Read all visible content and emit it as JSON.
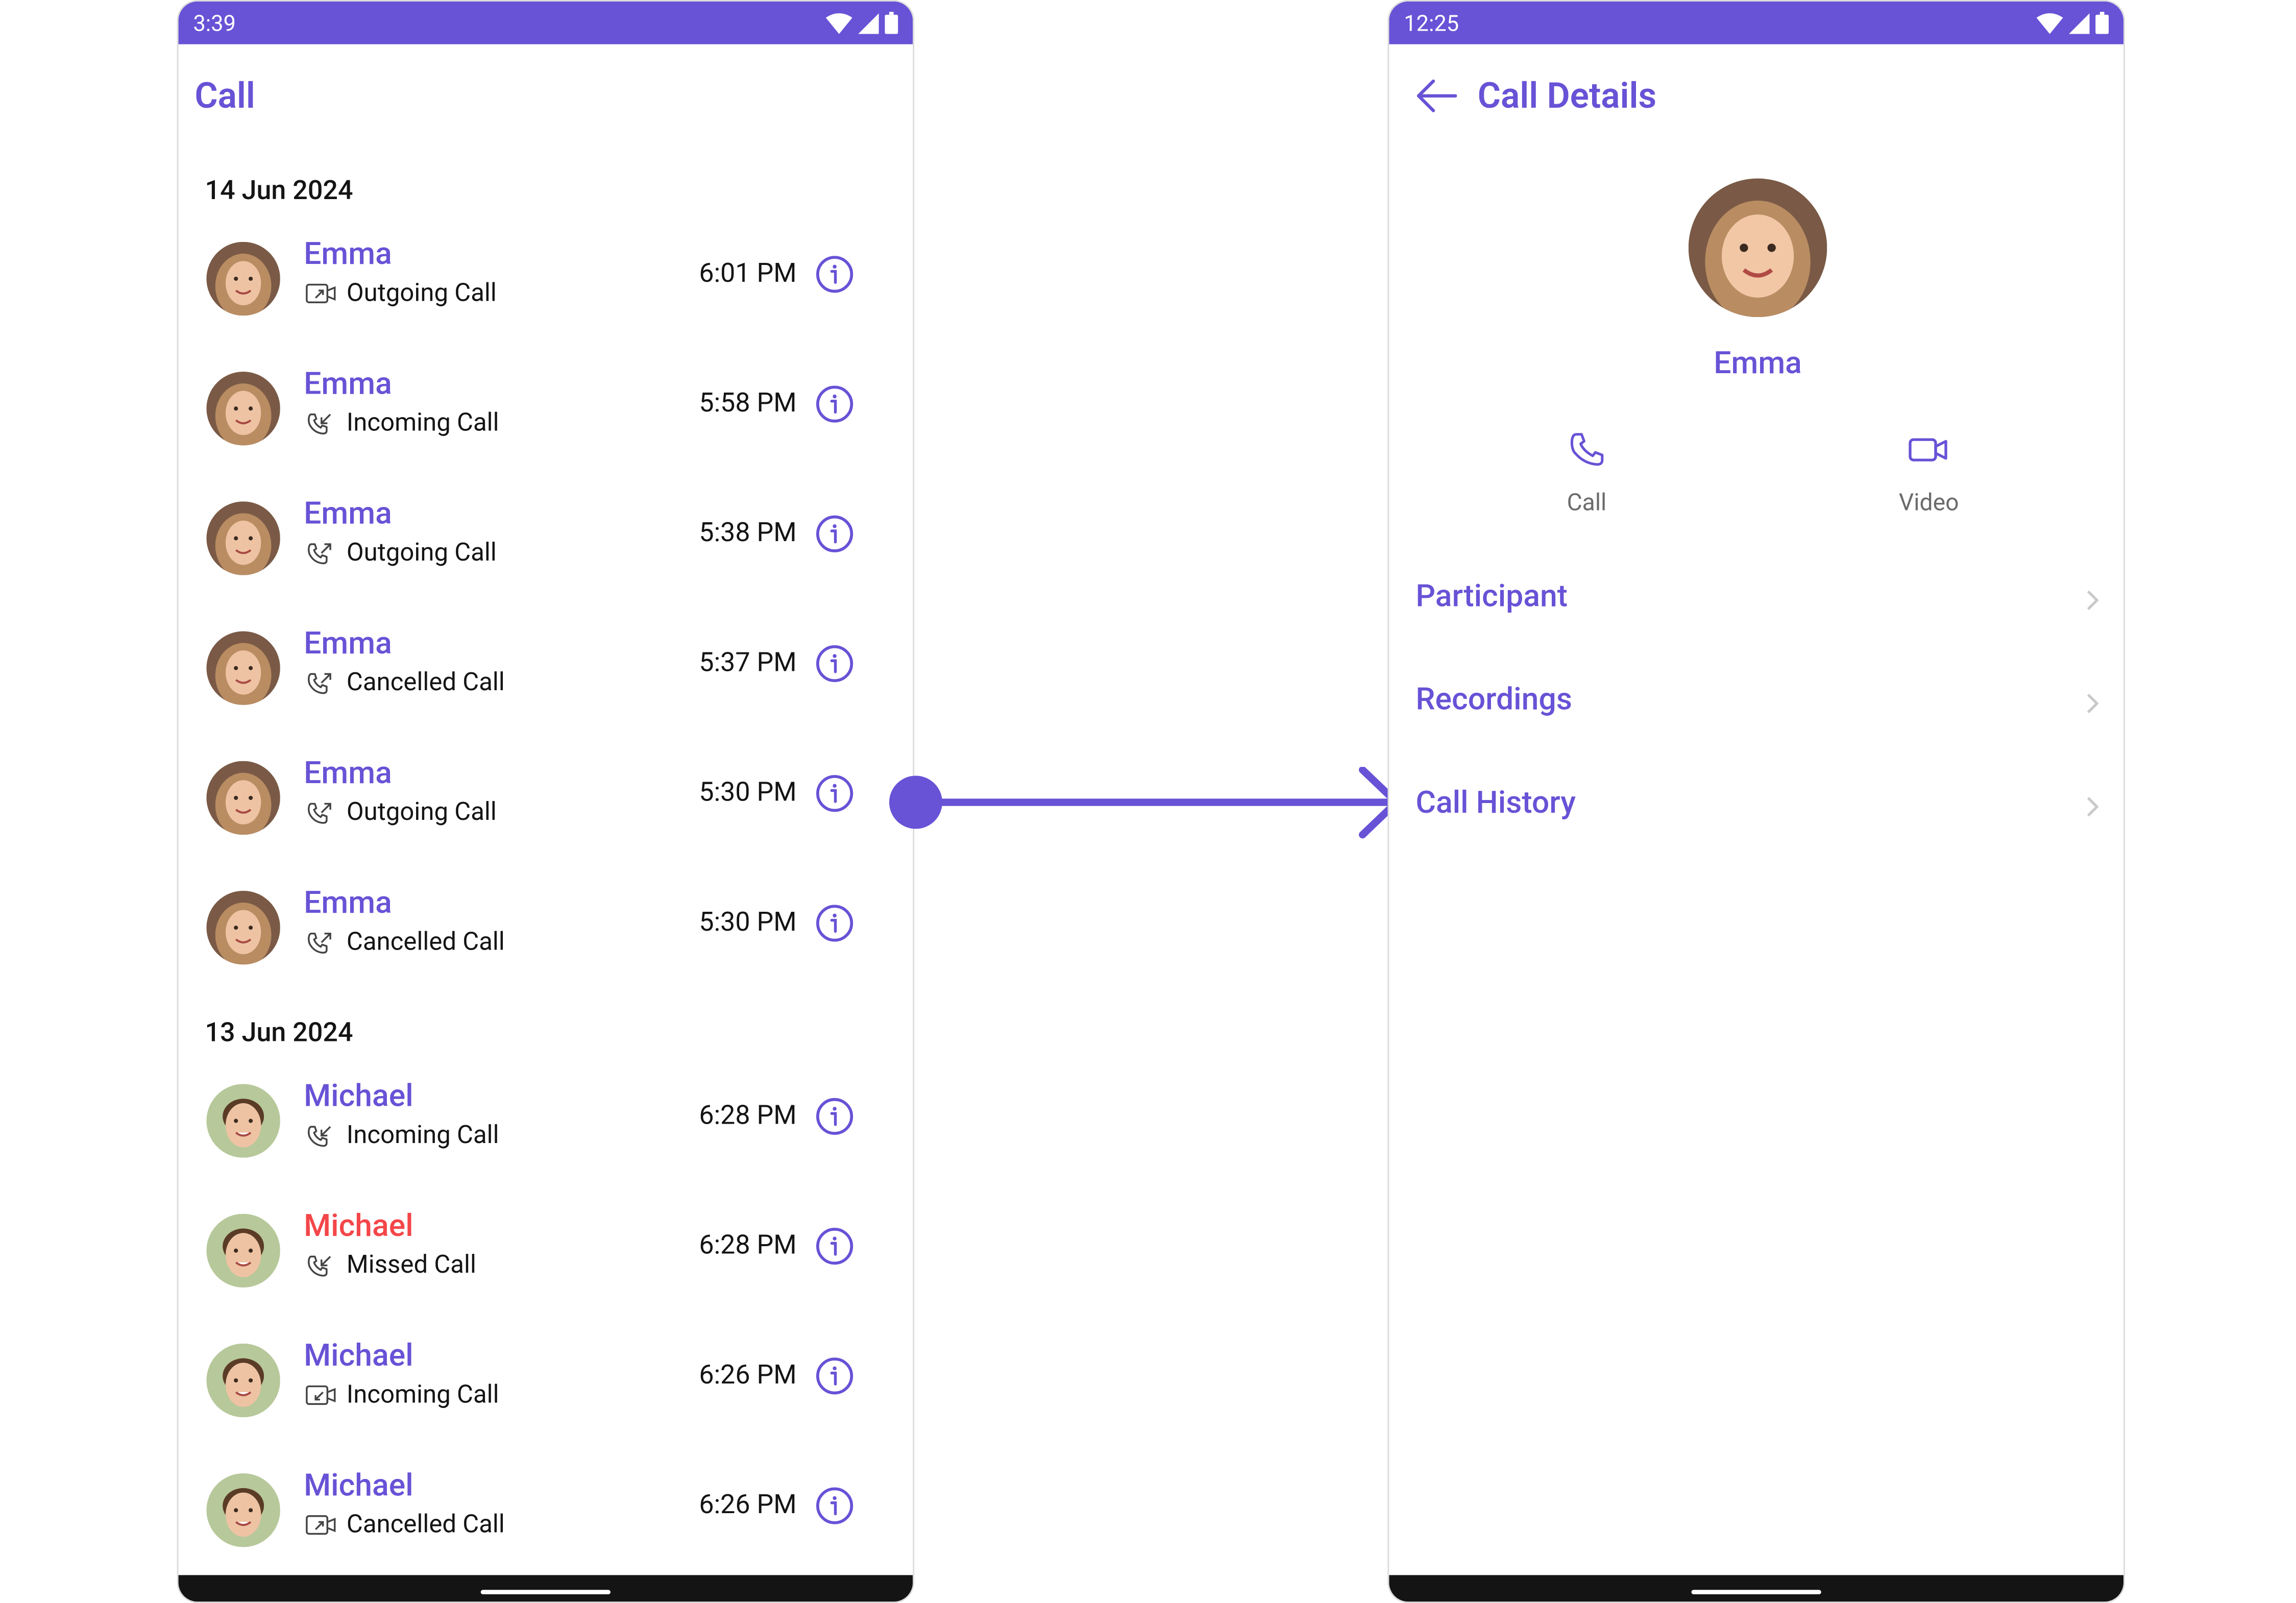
{
  "colors": {
    "accent": "#6852D6",
    "missed": "#F44649",
    "text": "#141414"
  },
  "left_phone": {
    "status_time": "3:39",
    "title": "Call",
    "groups": [
      {
        "date": "14 Jun 2024",
        "calls": [
          {
            "name": "Emma",
            "type": "Outgoing Call",
            "time": "6:01 PM",
            "icon": "video-outgoing-icon",
            "missed": false
          },
          {
            "name": "Emma",
            "type": "Incoming Call",
            "time": "5:58 PM",
            "icon": "phone-incoming-icon",
            "missed": false
          },
          {
            "name": "Emma",
            "type": "Outgoing Call",
            "time": "5:38 PM",
            "icon": "phone-outgoing-icon",
            "missed": false
          },
          {
            "name": "Emma",
            "type": "Cancelled Call",
            "time": "5:37 PM",
            "icon": "phone-outgoing-icon",
            "missed": false
          },
          {
            "name": "Emma",
            "type": "Outgoing Call",
            "time": "5:30 PM",
            "icon": "phone-outgoing-icon",
            "missed": false
          },
          {
            "name": "Emma",
            "type": "Cancelled Call",
            "time": "5:30 PM",
            "icon": "phone-outgoing-icon",
            "missed": false
          }
        ]
      },
      {
        "date": "13 Jun 2024",
        "calls": [
          {
            "name": "Michael",
            "type": "Incoming Call",
            "time": "6:28 PM",
            "icon": "phone-incoming-icon",
            "missed": false
          },
          {
            "name": "Michael",
            "type": "Missed Call",
            "time": "6:28 PM",
            "icon": "phone-incoming-icon",
            "missed": true
          },
          {
            "name": "Michael",
            "type": "Incoming Call",
            "time": "6:26 PM",
            "icon": "video-incoming-icon",
            "missed": false
          },
          {
            "name": "Michael",
            "type": "Cancelled Call",
            "time": "6:26 PM",
            "icon": "video-outgoing-icon",
            "missed": false
          }
        ]
      }
    ]
  },
  "right_phone": {
    "status_time": "12:25",
    "title": "Call Details",
    "profile_name": "Emma",
    "actions": [
      {
        "label": "Call",
        "icon": "phone-icon"
      },
      {
        "label": "Video",
        "icon": "video-camera-icon"
      }
    ],
    "options": [
      "Participant",
      "Recordings",
      "Call History"
    ]
  }
}
